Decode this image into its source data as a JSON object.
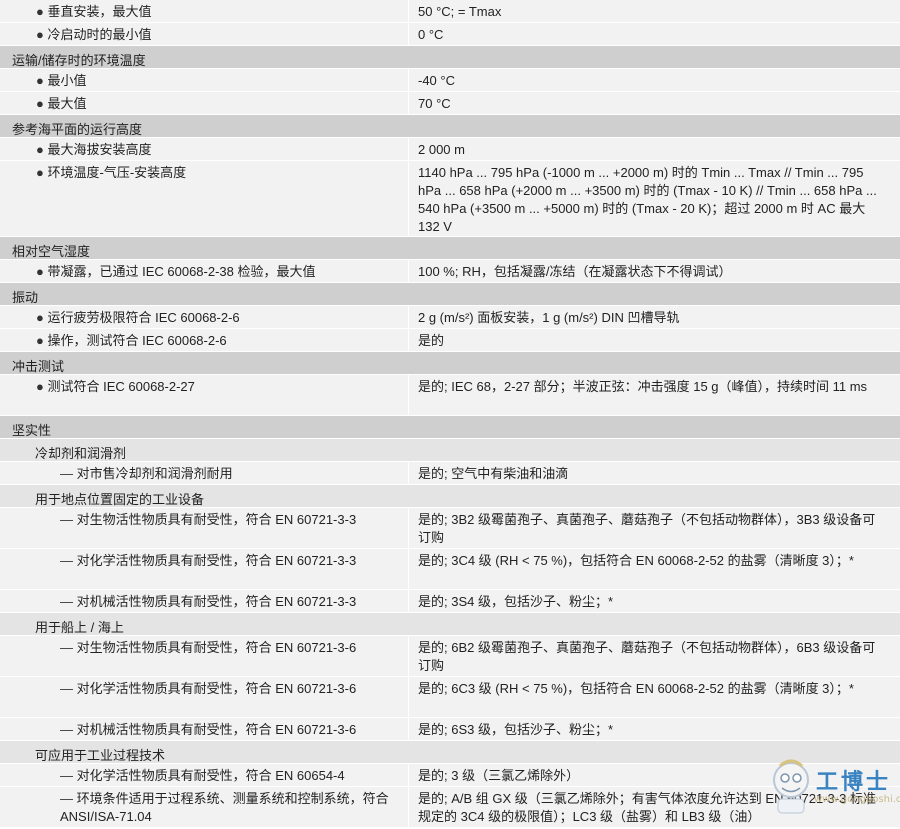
{
  "rows": [
    {
      "type": "item",
      "level": 1,
      "label": "垂直安装，最大值",
      "value": "50 °C; = Tmax",
      "lines": 1
    },
    {
      "type": "item",
      "level": 1,
      "label": "冷启动时的最小值",
      "value": "0 °C",
      "lines": 1
    },
    {
      "type": "section",
      "label": "运输/储存时的环境温度"
    },
    {
      "type": "item",
      "level": 1,
      "label": "最小值",
      "value": "-40 °C",
      "lines": 1
    },
    {
      "type": "item",
      "level": 1,
      "label": "最大值",
      "value": "70 °C",
      "lines": 1
    },
    {
      "type": "section",
      "label": "参考海平面的运行高度"
    },
    {
      "type": "item",
      "level": 1,
      "label": "最大海拔安装高度",
      "value": "2 000 m",
      "lines": 1
    },
    {
      "type": "item",
      "level": 1,
      "label": "环境温度-气压-安装高度",
      "value": "1140 hPa ... 795 hPa (-1000 m ... +2000 m) 时的 Tmin ... Tmax // Tmin ... 795 hPa ... 658 hPa (+2000 m ... +3500 m) 时的 (Tmax - 10 K) // Tmin ... 658 hPa ... 540 hPa (+3500 m ... +5000 m) 时的 (Tmax - 20 K)；超过 2000 m 时 AC 最大 132 V",
      "lines": 4
    },
    {
      "type": "section",
      "label": "相对空气湿度"
    },
    {
      "type": "item",
      "level": 1,
      "label": "带凝露，已通过 IEC 60068-2-38 检验，最大值",
      "value": "100 %; RH，包括凝露/冻结（在凝露状态下不得调试）",
      "lines": 1
    },
    {
      "type": "section",
      "label": "振动"
    },
    {
      "type": "item",
      "level": 1,
      "label": "运行疲劳极限符合 IEC 60068-2-6",
      "value": "2 g (m/s²) 面板安装，1 g (m/s²) DIN 凹槽导轨",
      "lines": 1
    },
    {
      "type": "item",
      "level": 1,
      "label": "操作，测试符合 IEC 60068-2-6",
      "value": "是的",
      "lines": 1
    },
    {
      "type": "section",
      "label": "冲击测试"
    },
    {
      "type": "item",
      "level": 1,
      "label": "测试符合 IEC 60068-2-27",
      "value": "是的; IEC 68，2-27 部分；半波正弦：冲击强度 15 g（峰值），持续时间 11 ms",
      "lines": 2
    },
    {
      "type": "section",
      "label": "坚实性"
    },
    {
      "type": "sub",
      "label": "冷却剂和润滑剂"
    },
    {
      "type": "item",
      "level": 2,
      "label": "对市售冷却剂和润滑剂耐用",
      "value": "是的; 空气中有柴油和油滴",
      "lines": 1
    },
    {
      "type": "sub",
      "label": "用于地点位置固定的工业设备"
    },
    {
      "type": "item",
      "level": 2,
      "label": "对生物活性物质具有耐受性，符合 EN 60721-3-3",
      "value": "是的; 3B2 级霉菌孢子、真菌孢子、蘑菇孢子（不包括动物群体），3B3 级设备可订购",
      "lines": 2
    },
    {
      "type": "item",
      "level": 2,
      "label": "对化学活性物质具有耐受性，符合 EN 60721-3-3",
      "value": "是的; 3C4 级 (RH < 75 %)，包括符合 EN 60068-2-52 的盐雾（清晰度 3）；*",
      "lines": 2
    },
    {
      "type": "item",
      "level": 2,
      "label": "对机械活性物质具有耐受性，符合 EN 60721-3-3",
      "value": "是的; 3S4 级，包括沙子、粉尘；*",
      "lines": 1
    },
    {
      "type": "sub",
      "label": "用于船上 / 海上"
    },
    {
      "type": "item",
      "level": 2,
      "label": "对生物活性物质具有耐受性，符合 EN 60721-3-6",
      "value": "是的; 6B2 级霉菌孢子、真菌孢子、蘑菇孢子（不包括动物群体），6B3 级设备可订购",
      "lines": 2
    },
    {
      "type": "item",
      "level": 2,
      "label": "对化学活性物质具有耐受性，符合 EN 60721-3-6",
      "value": "是的; 6C3 级 (RH < 75 %)，包括符合 EN 60068-2-52 的盐雾（清晰度 3）；*",
      "lines": 2
    },
    {
      "type": "item",
      "level": 2,
      "label": "对机械活性物质具有耐受性，符合 EN 60721-3-6",
      "value": "是的; 6S3 级，包括沙子、粉尘；*",
      "lines": 1
    },
    {
      "type": "sub",
      "label": "可应用于工业过程技术"
    },
    {
      "type": "item",
      "level": 2,
      "label": "对化学活性物质具有耐受性，符合 EN 60654-4",
      "value": "是的; 3 级（三氯乙烯除外）",
      "lines": 1
    },
    {
      "type": "item",
      "level": 2,
      "label": "环境条件适用于过程系统、测量系统和控制系统，符合 ANSI/ISA-71.04",
      "value": "是的; A/B 组 GX 级（三氯乙烯除外；有害气体浓度允许达到 EN 60721-3-3 标准规定的 3C4 级的极限值）；LC3 级（盐雾）和 LB3 级（油）",
      "lines": 2
    }
  ],
  "markers": {
    "bullet": "●",
    "dash": "—"
  },
  "watermark": {
    "brand": "工博士",
    "site": "www.gongboshi.com",
    "registered": "®"
  },
  "colors": {
    "section_bg": "#cfcfcf",
    "sub_bg": "#e4e4e4",
    "item_bg": "#f2f2f2",
    "watermark_blue": "#3a83c2"
  }
}
